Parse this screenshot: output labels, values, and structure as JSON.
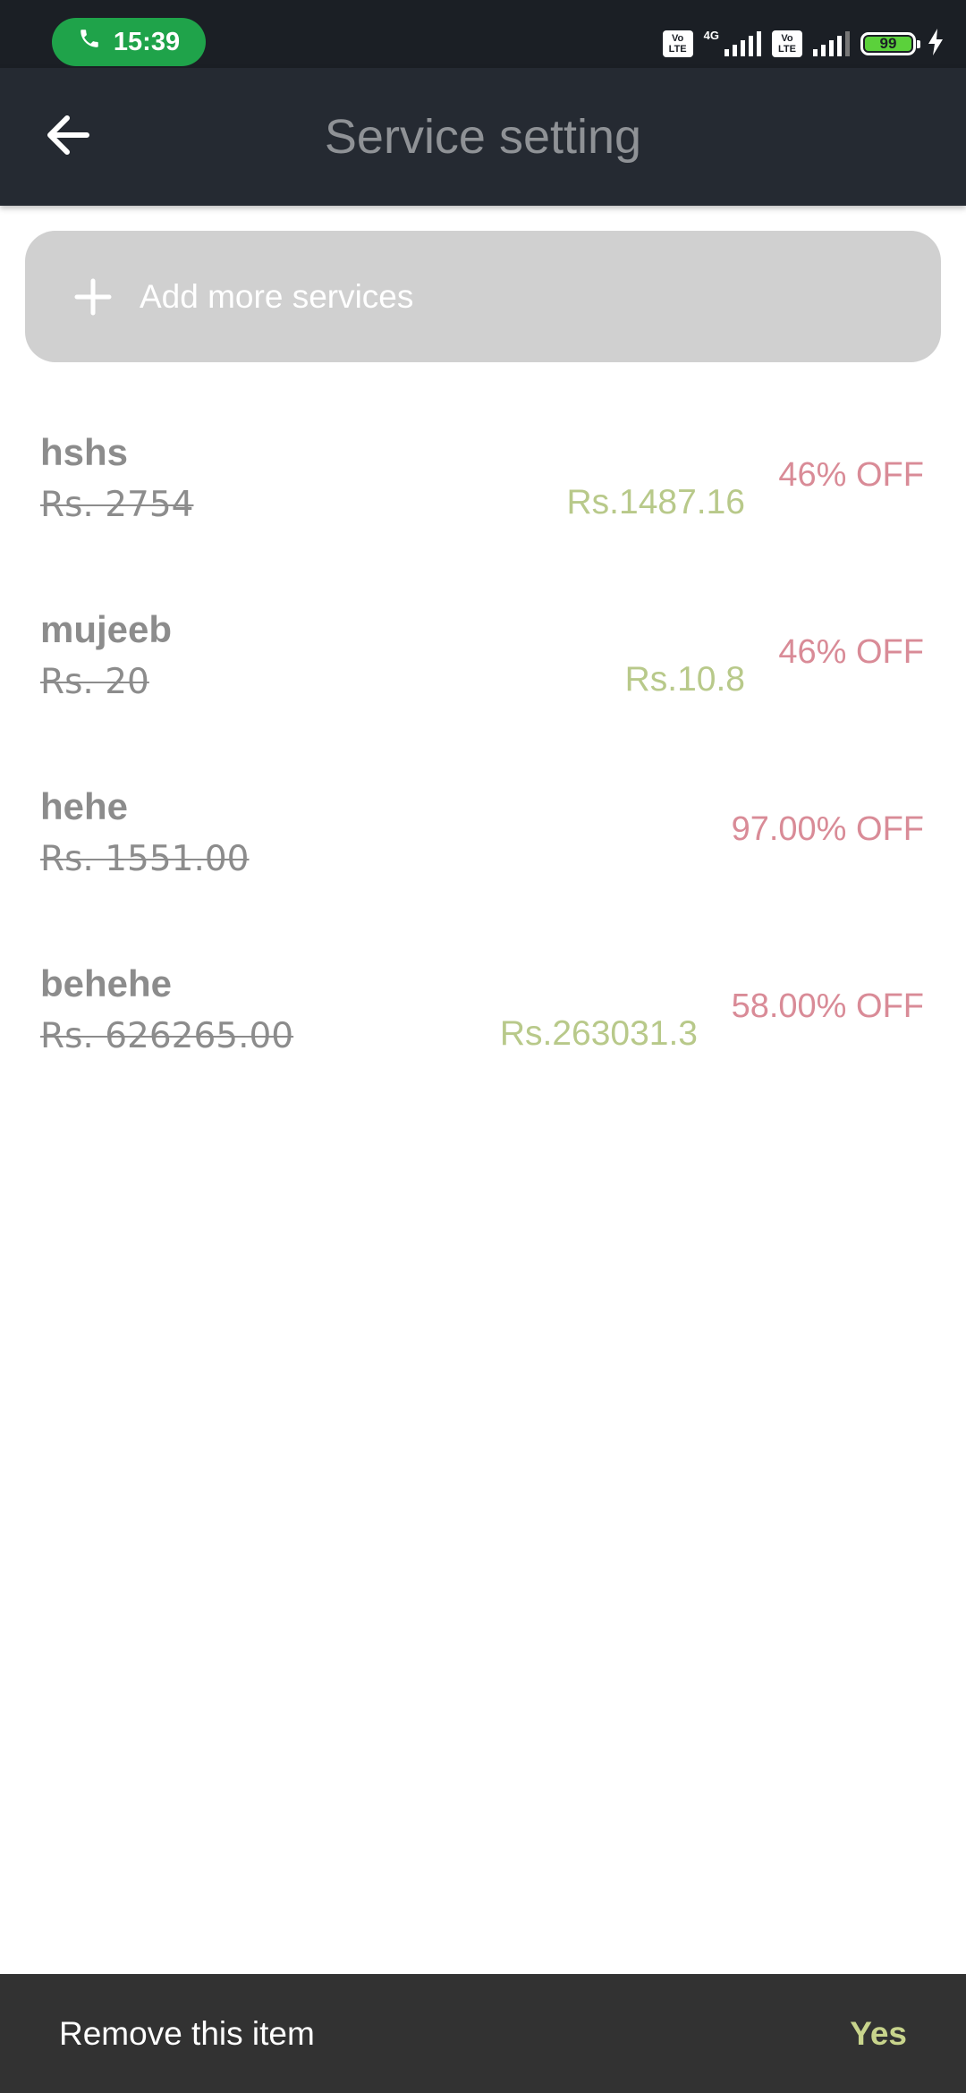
{
  "status_bar": {
    "time": "15:39",
    "net_type": "4G",
    "volte_1": "Vo LTE",
    "volte_2": "Vo LTE",
    "battery": "99",
    "icons": [
      "phone-icon",
      "volte-icon",
      "signal-icon",
      "battery-icon",
      "charging-icon"
    ],
    "call_color": "#1fa34a"
  },
  "toolbar": {
    "title": "Service setting",
    "back_icon": "arrow-left-icon"
  },
  "add_services": {
    "label": "Add more services",
    "icon": "plus-icon"
  },
  "services": [
    {
      "name": "hshs",
      "original_price": "Rs. 2754",
      "price": "Rs.1487.16",
      "discount": "46% OFF"
    },
    {
      "name": "mujeeb",
      "original_price": "Rs. 20",
      "price": "Rs.10.8",
      "discount": "46% OFF"
    },
    {
      "name": "hehe",
      "original_price": "Rs. 1551.00",
      "price": "",
      "discount": "97.00% OFF"
    },
    {
      "name": "behehe",
      "original_price": "Rs. 626265.00",
      "price": "Rs.263031.3",
      "discount": "58.00% OFF"
    }
  ],
  "snackbar": {
    "message": "Remove this item",
    "action": "Yes"
  },
  "colors": {
    "toolbar": "#252a32",
    "price": "#b8c98a",
    "discount": "#d98b97",
    "snackbar_action": "#c8d48c"
  }
}
